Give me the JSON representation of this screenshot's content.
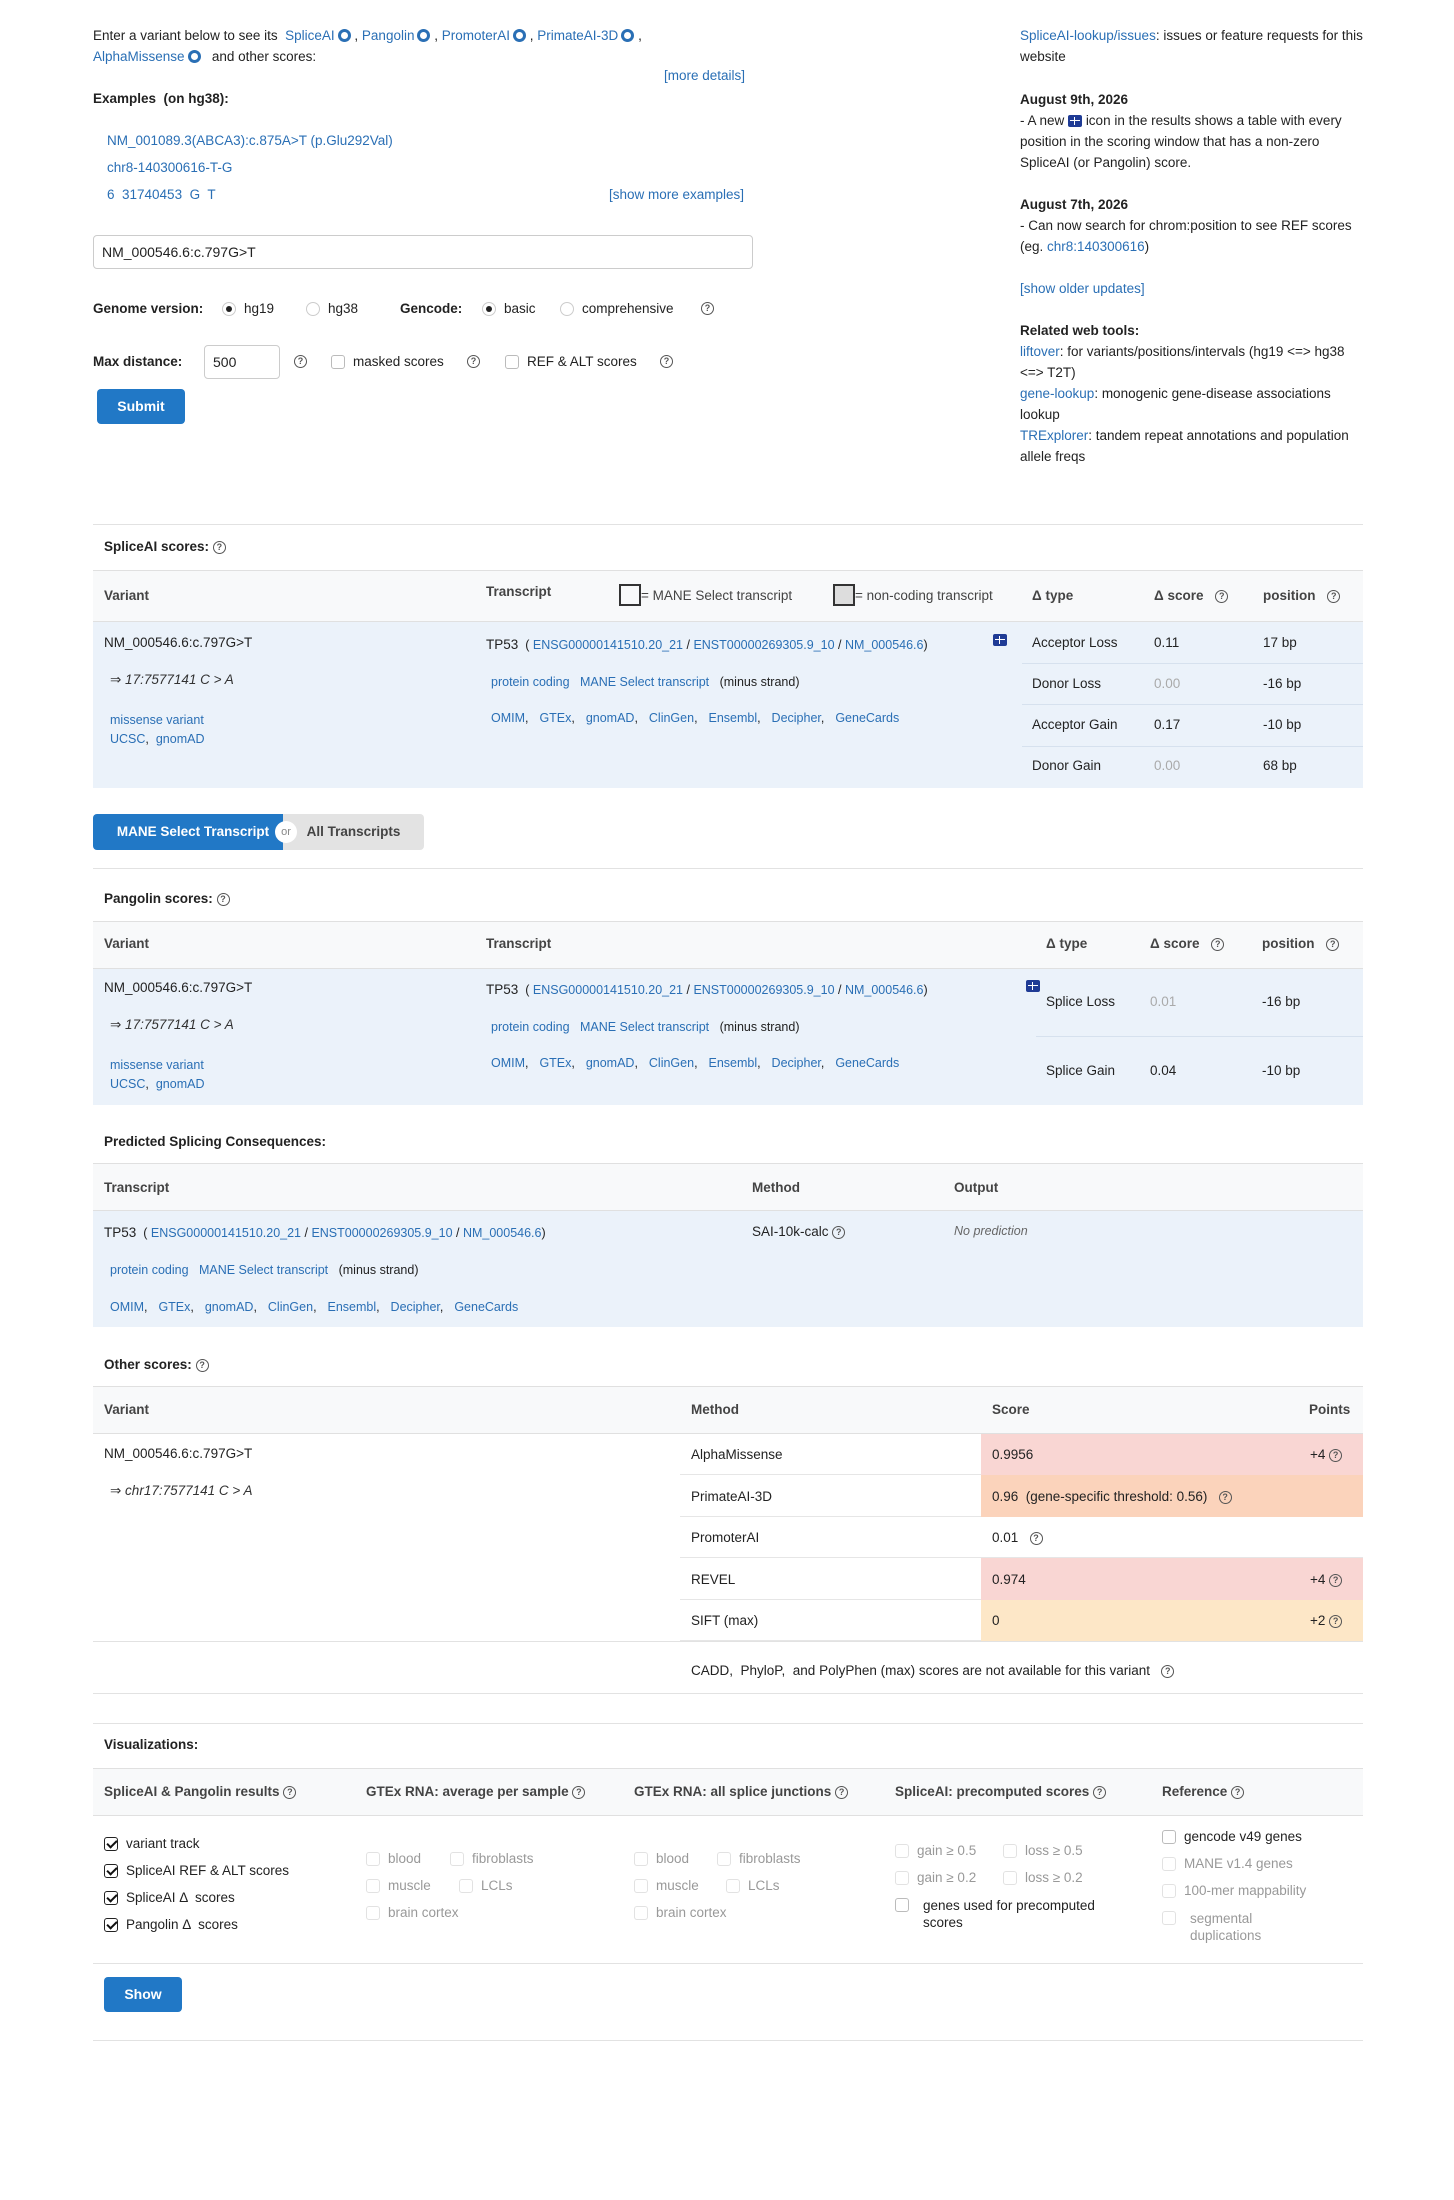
{
  "intro": {
    "prefix": "Enter a variant below to see its",
    "tools": [
      "SpliceAI",
      "Pangolin",
      "PromoterAI",
      "PrimateAI-3D",
      "AlphaMissense"
    ],
    "suffix": "and other scores:",
    "more_details": "[more details]"
  },
  "examples": {
    "label": "Examples  (on hg38):",
    "items": [
      "NM_001089.3(ABCA3):c.875A>T (p.Glu292Val)",
      "chr8-140300616-T-G",
      "6  31740453  G  T"
    ],
    "show_more": "[show more examples]"
  },
  "search": {
    "value": "NM_000546.6:c.797G>T"
  },
  "genome": {
    "label": "Genome version:",
    "options": [
      "hg19",
      "hg38"
    ],
    "selected": "hg19"
  },
  "gencode": {
    "label": "Gencode:",
    "options": [
      "basic",
      "comprehensive"
    ],
    "selected": "basic"
  },
  "maxdist": {
    "label": "Max distance:",
    "value": "500"
  },
  "opts": {
    "masked": "masked scores",
    "refalt": "REF & ALT scores"
  },
  "submit": "Submit",
  "sidebar": {
    "issues_link": "SpliceAI-lookup/issues",
    "issues_text": ": issues or feature requests for this website",
    "u1_date": "August 9th, 2026",
    "u1_a": "- A new",
    "u1_b": "icon in the results shows a table with every position in the scoring window that has a non-zero SpliceAI (or Pangolin) score.",
    "u2_date": "August 7th, 2026",
    "u2_a": "- Can now search for chrom:position to see REF scores (eg.",
    "u2_link": "chr8:140300616",
    "u2_b": ")",
    "older": "[show older updates]",
    "tools_title": "Related web tools:",
    "t1": "liftover",
    "t1_text": ": for variants/positions/intervals (hg19 <=> hg38 <=> T2T)",
    "t2": "gene-lookup",
    "t2_text": ": monogenic gene-disease associations lookup",
    "t3": "TRExplorer",
    "t3_text": ": tandem repeat annotations and population allele freqs"
  },
  "spliceai": {
    "title": "SpliceAI scores:",
    "headers": {
      "variant": "Variant",
      "transcript": "Transcript",
      "mane_legend": "= MANE Select transcript",
      "noncoding_legend": "= non-coding transcript",
      "dtype": "Δ type",
      "dscore": "Δ score",
      "position": "position"
    },
    "variant": "NM_000546.6:c.797G>T",
    "coords": "⇒ 17:7577141 C > A",
    "consequence": "missense variant",
    "vlinks": [
      "UCSC",
      "gnomAD"
    ],
    "gene": "TP53",
    "ids": [
      "ENSG00000141510.20_21",
      "ENST00000269305.9_10",
      "NM_000546.6"
    ],
    "tags": [
      "protein coding",
      "MANE Select transcript"
    ],
    "strand": "(minus strand)",
    "glinks": [
      "OMIM",
      "GTEx",
      "gnomAD",
      "ClinGen",
      "Ensembl",
      "Decipher",
      "GeneCards"
    ],
    "rows": [
      [
        "Acceptor Loss",
        "0.11",
        "17 bp"
      ],
      [
        "Donor Loss",
        "0.00",
        "-16 bp"
      ],
      [
        "Acceptor Gain",
        "0.17",
        "-10 bp"
      ],
      [
        "Donor Gain",
        "0.00",
        "68 bp"
      ]
    ]
  },
  "toggle": {
    "mane": "MANE Select Transcript",
    "or": "or",
    "all": "All Transcripts"
  },
  "pangolin": {
    "title": "Pangolin scores:",
    "rows": [
      [
        "Splice Loss",
        "0.01",
        "-16 bp"
      ],
      [
        "Splice Gain",
        "0.04",
        "-10 bp"
      ]
    ]
  },
  "psc": {
    "title": "Predicted Splicing Consequences:",
    "h_transcript": "Transcript",
    "h_method": "Method",
    "h_output": "Output",
    "method": "SAI-10k-calc",
    "output": "No prediction"
  },
  "other": {
    "title": "Other scores:",
    "h_variant": "Variant",
    "h_method": "Method",
    "h_score": "Score",
    "h_points": "Points",
    "variant": "NM_000546.6:c.797G>T",
    "coords": "⇒ chr17:7577141 C > A",
    "rows": [
      [
        "AlphaMissense",
        "0.9956",
        "+4"
      ],
      [
        "PrimateAI-3D",
        "0.96  (gene-specific threshold: 0.56)",
        ""
      ],
      [
        "PromoterAI",
        "0.01",
        ""
      ],
      [
        "REVEL",
        "0.974",
        "+4"
      ],
      [
        "SIFT (max)",
        "0",
        "+2"
      ]
    ],
    "colors": {
      "pink": "#f9d6d3",
      "orange": "#fbd3bb",
      "yellow": "#fde7c7"
    },
    "note": "CADD,  PhyloP,  and PolyPhen (max) scores are not available for this variant"
  },
  "viz": {
    "title": "Visualizations:",
    "h1": "SpliceAI & Pangolin results",
    "h2": "GTEx RNA: average per sample",
    "h3": "GTEx RNA: all splice junctions",
    "h4": "SpliceAI: precomputed scores",
    "h5": "Reference",
    "c1": [
      "variant track",
      "SpliceAI REF & ALT scores",
      "SpliceAI Δ  scores",
      "Pangolin Δ  scores"
    ],
    "gtex": [
      "blood",
      "fibroblasts",
      "muscle",
      "LCLs",
      "brain cortex"
    ],
    "pre": [
      "gain ≥ 0.5",
      "loss ≥ 0.5",
      "gain ≥ 0.2",
      "loss ≥ 0.2",
      "genes used for precomputed scores"
    ],
    "ref": [
      "gencode v49 genes",
      "MANE v1.4 genes",
      "100-mer mappability",
      "segmental duplications"
    ],
    "show": "Show"
  }
}
